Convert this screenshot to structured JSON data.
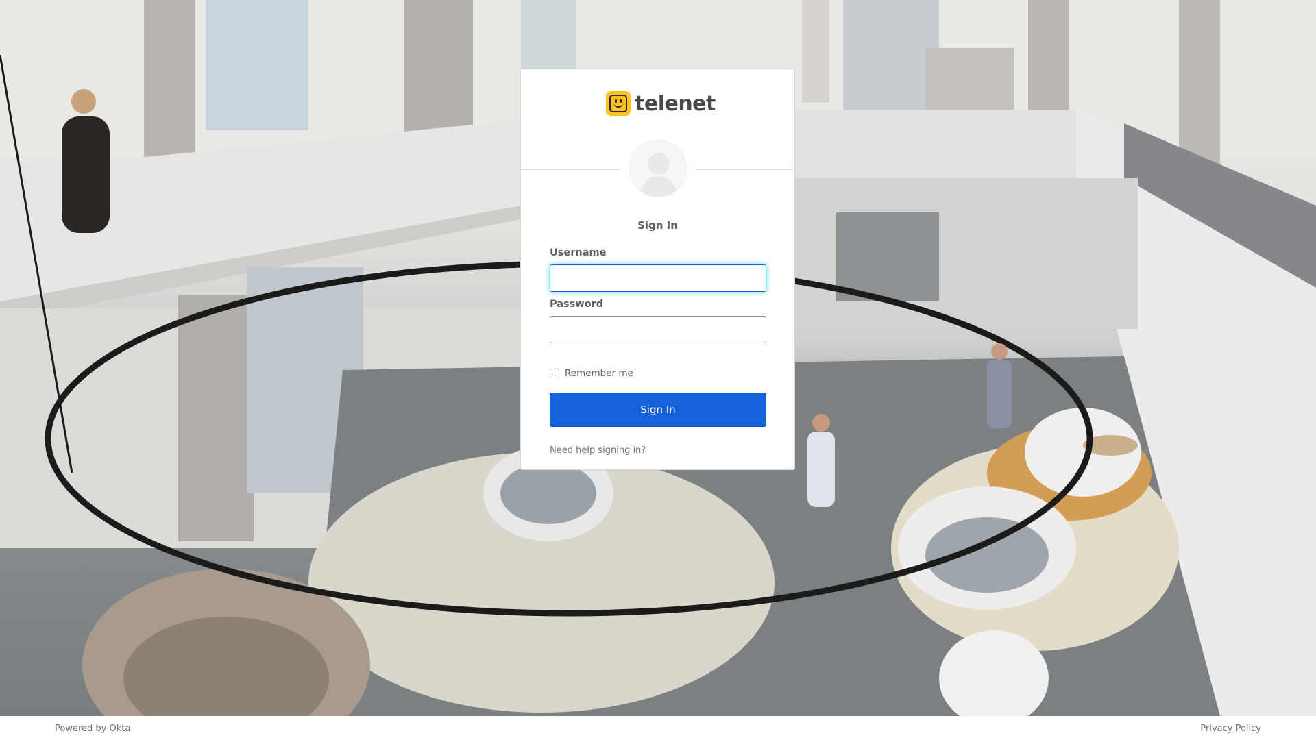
{
  "brand": {
    "name": "telenet",
    "logo_color": "#ffc325"
  },
  "login": {
    "title": "Sign In",
    "username_label": "Username",
    "username_value": "",
    "password_label": "Password",
    "password_value": "",
    "remember_label": "Remember me",
    "remember_checked": false,
    "submit_label": "Sign In",
    "help_link": "Need help signing in?",
    "avatar_icon": "user-silhouette-icon"
  },
  "footer": {
    "powered_by": "Powered by Okta",
    "privacy": "Privacy Policy"
  },
  "colors": {
    "primary_button": "#1662dd",
    "focus_glow": "#51cbee",
    "text": "#5e5e5e"
  }
}
